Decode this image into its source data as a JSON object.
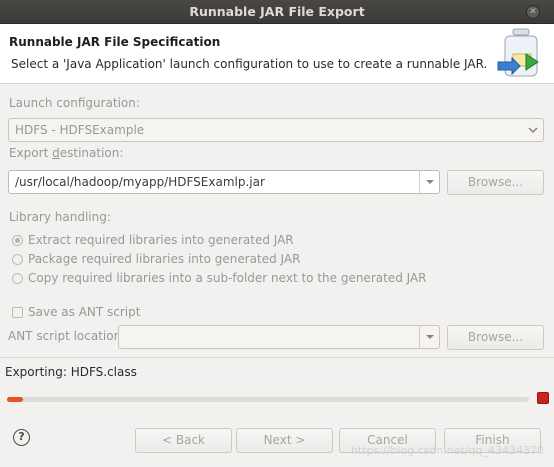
{
  "window": {
    "title": "Runnable JAR File Export"
  },
  "header": {
    "title": "Runnable JAR File Specification",
    "description": "Select a 'Java Application' launch configuration to use to create a runnable JAR."
  },
  "launch": {
    "label": "Launch configuration:",
    "value": "HDFS - HDFSExample"
  },
  "export": {
    "label": "Export destination:",
    "value": "/usr/local/hadoop/myapp/HDFSExamlp.jar",
    "browse": "Browse..."
  },
  "library": {
    "label": "Library handling:",
    "options": [
      "Extract required libraries into generated JAR",
      "Package required libraries into generated JAR",
      "Copy required libraries into a sub-folder next to the generated JAR"
    ],
    "selected_index": 0
  },
  "ant": {
    "save_label": "Save as ANT script",
    "location_label": "ANT script location:",
    "location_value": "",
    "browse": "Browse..."
  },
  "status": {
    "text": "Exporting: HDFS.class",
    "progress_fraction": 0.03
  },
  "buttons": {
    "back": "< Back",
    "next": "Next >",
    "cancel": "Cancel",
    "finish": "Finish"
  },
  "watermark": "https://blog.csdn.net/qq_43434370",
  "colors": {
    "progress": "#e2571f",
    "stop": "#c9231c"
  }
}
